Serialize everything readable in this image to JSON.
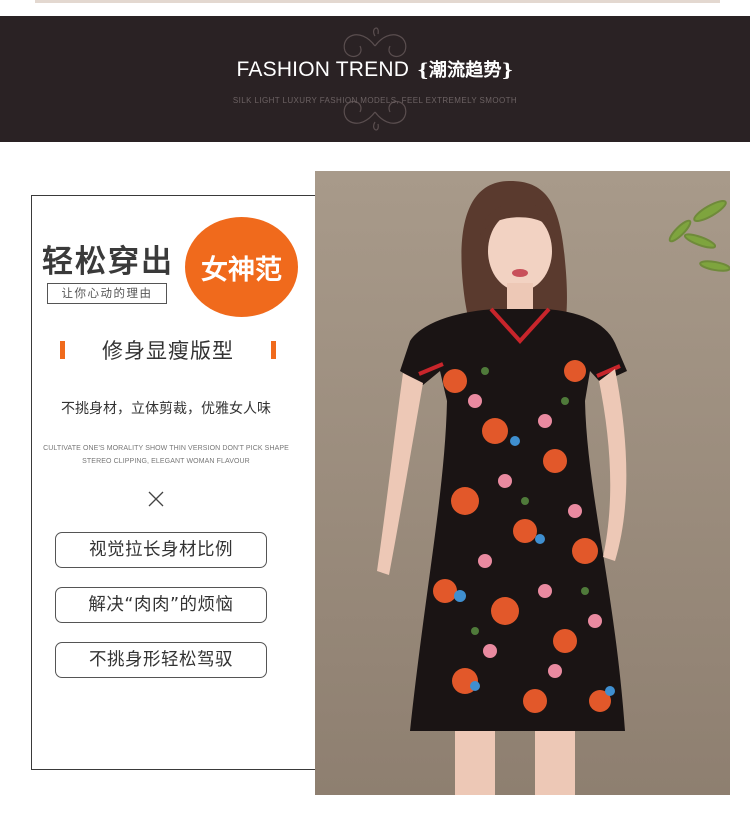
{
  "banner": {
    "title": "FASHION TREND",
    "title_cn": "{潮流趋势}",
    "subtitle": "SILK LIGHT LUXURY FASHION MODELS, FEEL EXTREMELY SMOOTH"
  },
  "promo": {
    "headline": "轻松穿出",
    "circle_text": "女神范",
    "tag": "让你心动的理由",
    "feature": "修身显瘦版型",
    "description": "不挑身材，立体剪裁，优雅女人味",
    "english_line1": "CULTIVATE ONE'S MORALITY SHOW THIN VERSION DON'T PICK SHAPE",
    "english_line2": "STEREO CLIPPING, ELEGANT WOMAN FLAVOUR",
    "benefits": [
      "视觉拉长身材比例",
      "解决“肉肉”的烦恼",
      "不挑身形轻松驾驭"
    ]
  },
  "colors": {
    "accent": "#f06a1c",
    "banner_bg": "#2a2224",
    "photo_bg": "#9e8f7f"
  }
}
